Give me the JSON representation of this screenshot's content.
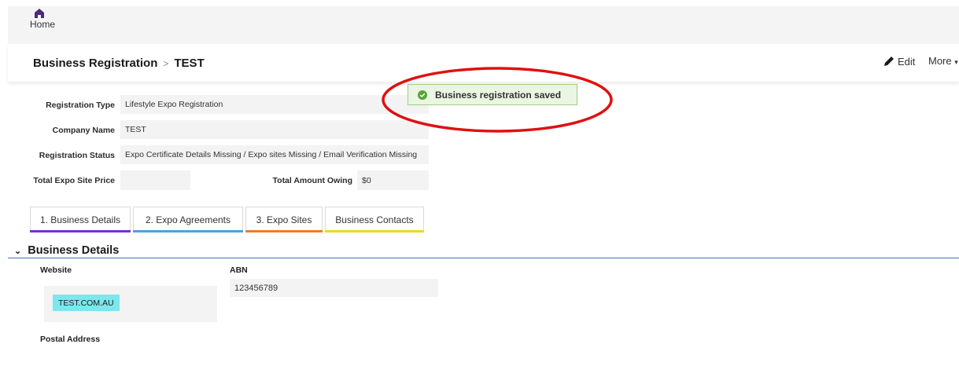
{
  "nav": {
    "home_label": "Home"
  },
  "header": {
    "breadcrumb_parent": "Business Registration",
    "breadcrumb_separator": ">",
    "breadcrumb_current": "TEST",
    "edit_label": "Edit",
    "more_label": "More"
  },
  "toast": {
    "message": "Business registration saved",
    "color": "#9ccf82"
  },
  "annotation": {
    "color": "#e01010"
  },
  "fields": {
    "registration_type": {
      "label": "Registration Type",
      "value": "Lifestyle Expo Registration"
    },
    "company_name": {
      "label": "Company Name",
      "value": "TEST"
    },
    "registration_status": {
      "label": "Registration Status",
      "value": "Expo Certificate Details Missing / Expo sites Missing / Email Verification Missing"
    },
    "total_expo_site_price": {
      "label": "Total Expo Site Price",
      "value": ""
    },
    "total_amount_owing": {
      "label": "Total Amount Owing",
      "value": "$0"
    }
  },
  "tabs": [
    {
      "label": "1. Business Details",
      "color": "#7a2fd6"
    },
    {
      "label": "2. Expo Agreements",
      "color": "#4aa3df"
    },
    {
      "label": "3. Expo Sites",
      "color": "#f07b2a"
    },
    {
      "label": "Business Contacts",
      "color": "#f0d81f"
    }
  ],
  "section": {
    "title": "Business Details",
    "website_label": "Website",
    "website_value": "TEST.COM.AU",
    "abn_label": "ABN",
    "abn_value": "123456789",
    "postal_label": "Postal Address"
  }
}
